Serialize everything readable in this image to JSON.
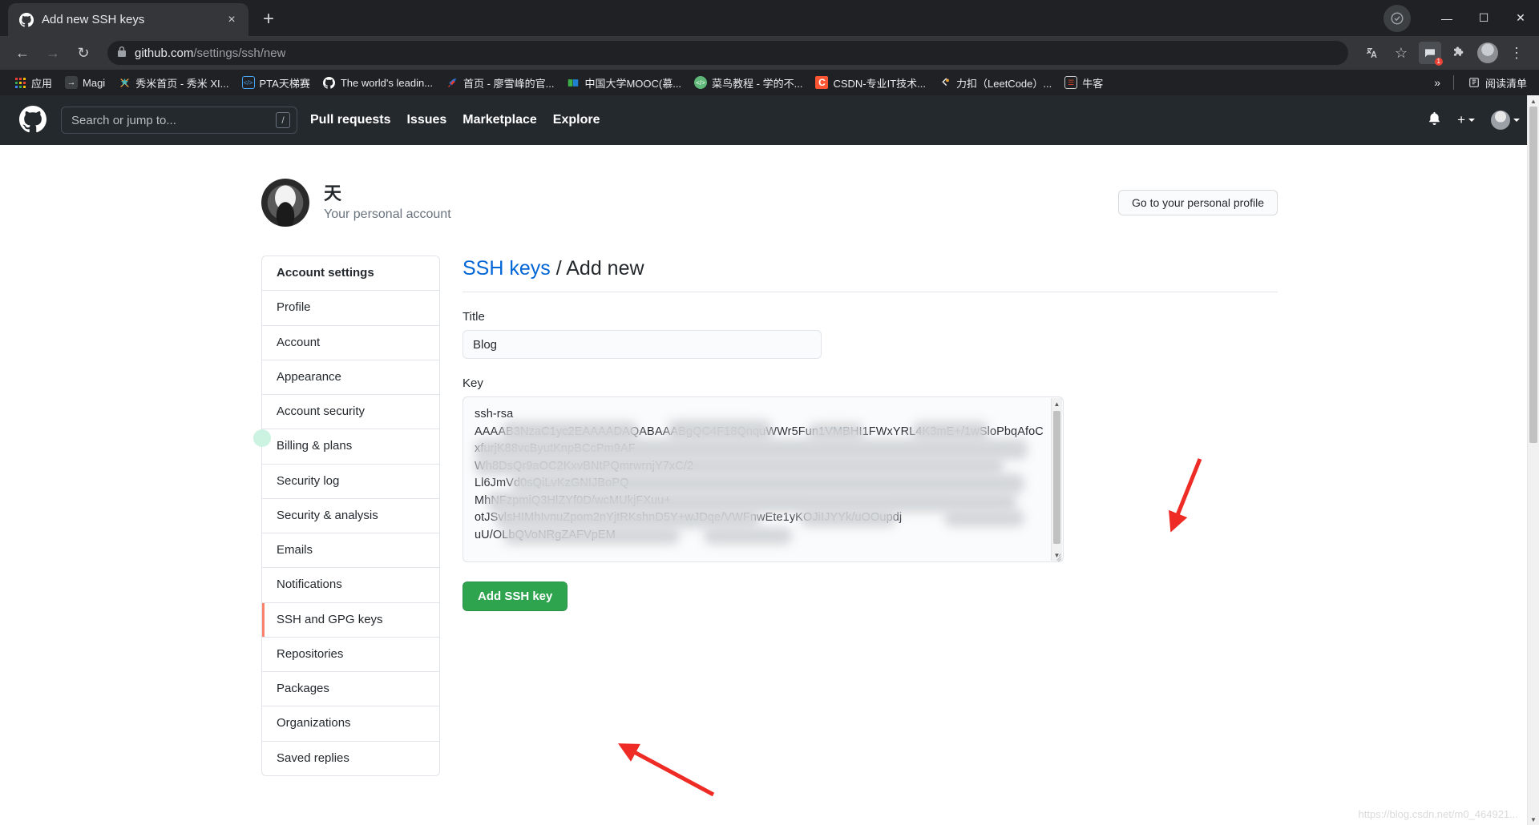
{
  "browser": {
    "tab": {
      "title": "Add new SSH keys",
      "favicon": "github-icon",
      "close": "×"
    },
    "new_tab_label": "+",
    "window_controls": {
      "minimize": "—",
      "maximize": "☐",
      "close": "✕"
    },
    "nav": {
      "back": "←",
      "forward": "→",
      "reload": "↻",
      "lock": "🔒"
    },
    "url_bold": "github.com",
    "url_dim": "/settings/ssh/new",
    "toolbar_icons": {
      "translate": "translate-icon",
      "bookmark_star": "☆",
      "extension_badge": "1",
      "puzzle": "extensions-icon",
      "menu": "⋮"
    },
    "bookmarks": [
      {
        "label": "应用",
        "icon": "apps-grid-icon"
      },
      {
        "label": "Magi",
        "icon": "magi-icon"
      },
      {
        "label": "秀米首页 - 秀米 XI...",
        "icon": "xiumi-icon"
      },
      {
        "label": "PTA天梯赛",
        "icon": "pta-icon"
      },
      {
        "label": "The world's leadin...",
        "icon": "github-icon"
      },
      {
        "label": "首页 - 廖雪峰的官...",
        "icon": "rocket-icon"
      },
      {
        "label": "中国大学MOOC(慕...",
        "icon": "mooc-icon"
      },
      {
        "label": "菜鸟教程 - 学的不...",
        "icon": "runoob-icon"
      },
      {
        "label": "CSDN-专业IT技术...",
        "icon": "csdn-icon"
      },
      {
        "label": "力扣（LeetCode）...",
        "icon": "leetcode-icon"
      },
      {
        "label": "牛客",
        "icon": "nowcoder-icon"
      }
    ],
    "bookmarks_overflow": "»",
    "reading_list": {
      "label": "阅读清单",
      "icon": "reading-list-icon"
    }
  },
  "github": {
    "header": {
      "logo": "github-mark-icon",
      "search_placeholder": "Search or jump to...",
      "search_shortcut": "/",
      "nav": [
        "Pull requests",
        "Issues",
        "Marketplace",
        "Explore"
      ],
      "bell": "notifications-icon",
      "plus": "+",
      "avatar": "user-avatar"
    },
    "account": {
      "name": "天",
      "subtitle": "Your personal account",
      "profile_button": "Go to your personal profile"
    },
    "sidebar": {
      "items": [
        {
          "label": "Account settings",
          "active": false,
          "header": true
        },
        {
          "label": "Profile",
          "active": false
        },
        {
          "label": "Account",
          "active": false
        },
        {
          "label": "Appearance",
          "active": false
        },
        {
          "label": "Account security",
          "active": false
        },
        {
          "label": "Billing & plans",
          "active": false
        },
        {
          "label": "Security log",
          "active": false
        },
        {
          "label": "Security & analysis",
          "active": false
        },
        {
          "label": "Emails",
          "active": false
        },
        {
          "label": "Notifications",
          "active": false
        },
        {
          "label": "SSH and GPG keys",
          "active": true
        },
        {
          "label": "Repositories",
          "active": false
        },
        {
          "label": "Packages",
          "active": false
        },
        {
          "label": "Organizations",
          "active": false
        },
        {
          "label": "Saved replies",
          "active": false
        }
      ]
    },
    "main": {
      "breadcrumb_link": "SSH keys",
      "breadcrumb_sep": " / ",
      "breadcrumb_current": "Add new",
      "title_label": "Title",
      "title_value": "Blog",
      "key_label": "Key",
      "key_value": "ssh-rsa\nAAAAB3NzaC1yc2EAAAADAQABAAABgQC4F18QnquWWr5Fun1VMBHI1FWxYRL4K3mE+/1wSloPbqAfoC\nxfurjK88vcByutKnpBCcPm9AF\nWh8DsQr9aOC2KxvBNtPQmrwrnjY7xC/2\nLl6JmVd0sQiLvKzGNIJBoPQ\nMhNFzpmiQ3HlZYf0D/wcMUkjFXuu+\notJSvlsHIMhIvnuZpom2nYjtRKshnD5Y+wJDqe/VWFnwEte1yKOJiIJYYk/uOOupdj\nuU/OLbQVoNRgZAFVpEM",
      "submit_button": "Add SSH key"
    },
    "watermark": "https://blog.csdn.net/m0_464921..."
  },
  "colors": {
    "github_header": "#24292e",
    "link_blue": "#0366d6",
    "green_button": "#2ea44f",
    "active_marker": "#f9826c",
    "arrow_red": "#ee2b24"
  }
}
